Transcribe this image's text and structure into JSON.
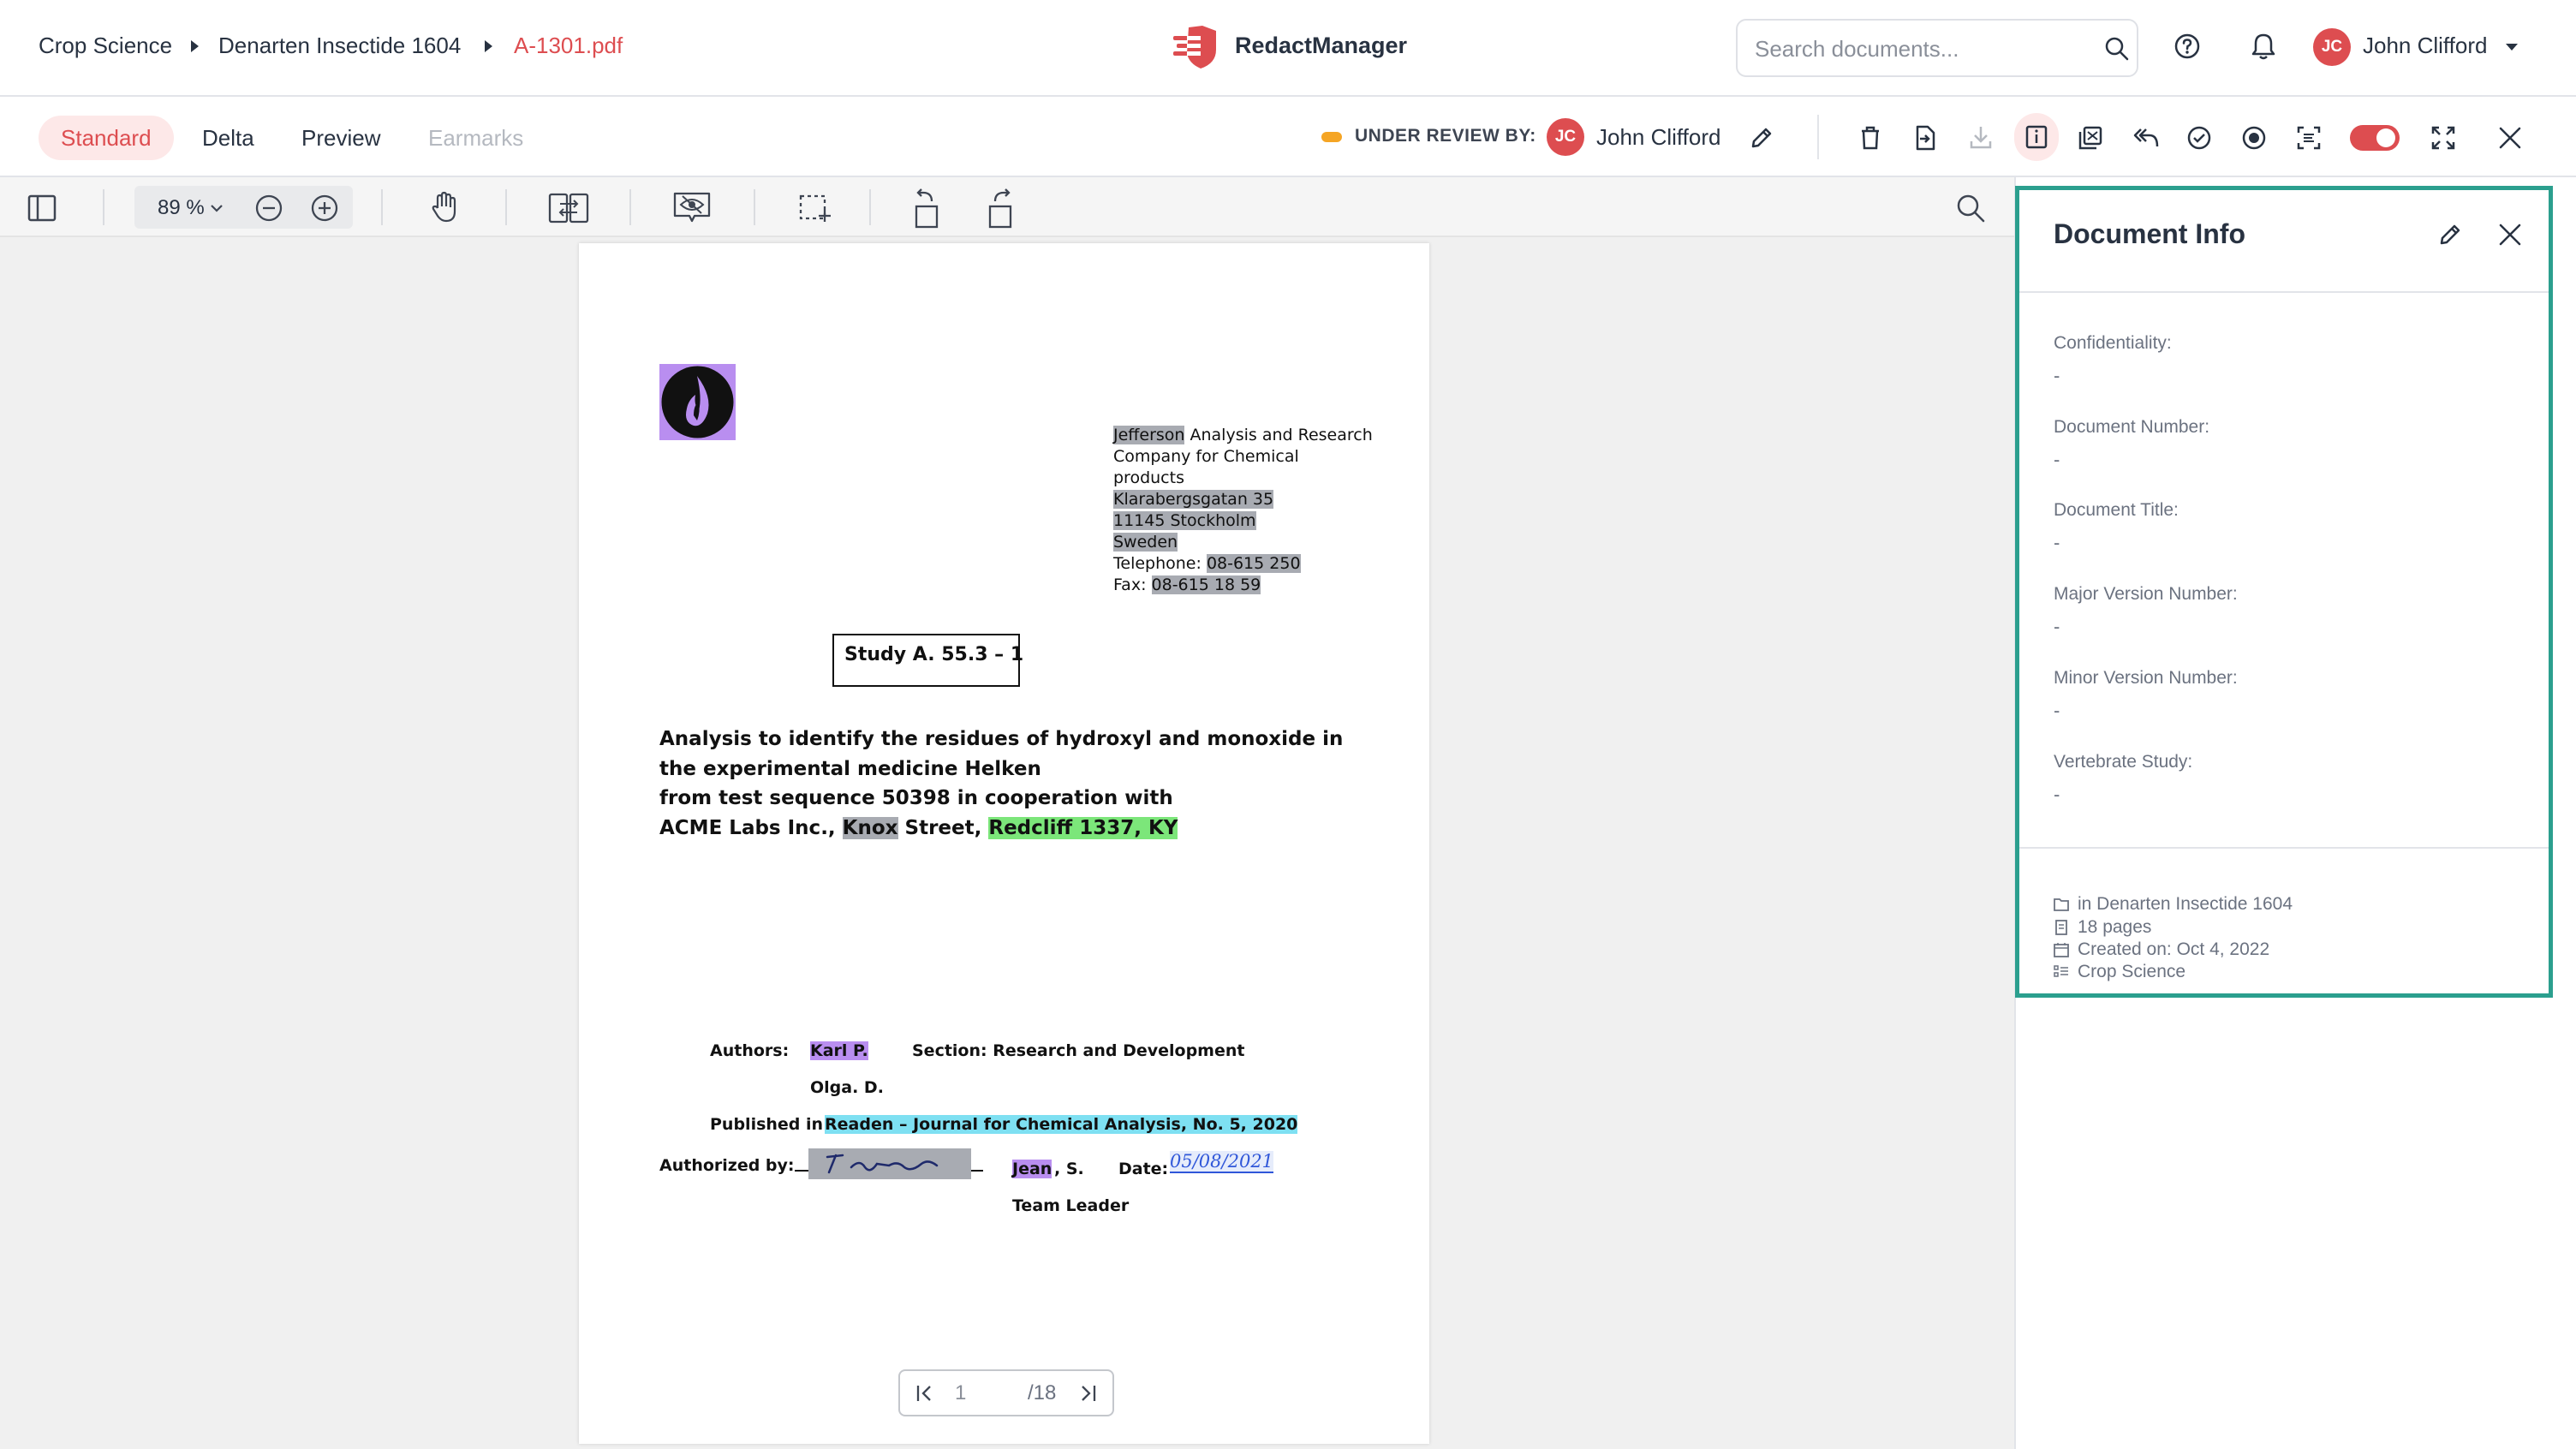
{
  "header": {
    "breadcrumbs": [
      "Crop Science",
      "Denarten Insectide 1604",
      "A-1301.pdf"
    ],
    "app_name": "RedactManager",
    "search": {
      "placeholder": "Search documents...",
      "value": ""
    },
    "user": {
      "initials": "JC",
      "name": "John Clifford"
    }
  },
  "subbar": {
    "tabs": [
      {
        "label": "Standard",
        "state": "active"
      },
      {
        "label": "Delta",
        "state": "normal"
      },
      {
        "label": "Preview",
        "state": "normal"
      },
      {
        "label": "Earmarks",
        "state": "disabled"
      }
    ],
    "status_label": "UNDER REVIEW BY:",
    "reviewer": {
      "initials": "JC",
      "name": "John Clifford"
    },
    "status_color": "#f5a524"
  },
  "viewer": {
    "zoom": "89 %",
    "pager": {
      "current": "1",
      "total": "/18"
    }
  },
  "document": {
    "address": {
      "line1_hl": "Jefferson",
      "line1_rest": " Analysis and Research",
      "line2": "Company for Chemical",
      "line3": "products",
      "line4": "Klarabergsgatan 35",
      "line5": "11145 Stockholm",
      "line6": "Sweden",
      "tel_label": "Telephone: ",
      "tel": "08-615 250",
      "fax_label": "Fax: ",
      "fax": "08-615 18 59"
    },
    "study_box": "Study A. 55.3 – 1",
    "title": {
      "line1": "Analysis to identify the residues of hydroxyl and monoxide in",
      "line2": "the experimental medicine Helken",
      "line3": "from test sequence 50398 in cooperation with",
      "line4_a": "ACME Labs Inc., ",
      "line4_hl1": "Knox",
      "line4_b": " Street, ",
      "line4_hl2": "Redcliff 1337, KY"
    },
    "authors_label": "Authors:",
    "author1": "Karl P.",
    "section": "Section: Research and Development",
    "author2": "Olga. D.",
    "published_label": "Published in: ",
    "published": "Readen – Journal for Chemical Analysis, No. 5, 2020",
    "authorized_label": "Authorized by:",
    "signer_hl": "Jean",
    "signer_rest": ", S.",
    "date_label": "Date:",
    "date_value": "05/08/2021",
    "role": "Team Leader"
  },
  "panel": {
    "title": "Document Info",
    "fields": [
      {
        "label": "Confidentiality:",
        "value": "-"
      },
      {
        "label": "Document Number:",
        "value": "-"
      },
      {
        "label": "Document Title:",
        "value": "-"
      },
      {
        "label": "Major Version Number:",
        "value": "-"
      },
      {
        "label": "Minor Version Number:",
        "value": "-"
      },
      {
        "label": "Vertebrate Study:",
        "value": "-"
      }
    ],
    "meta": {
      "folder": "in Denarten Insectide 1604",
      "pages": "18 pages",
      "created": "Created on: Oct 4, 2022",
      "dossier": "Crop Science"
    },
    "highlight_color": "#2b9f8e"
  },
  "colors": {
    "accent": "#dd4d50",
    "logo_icon": "#b98ef0"
  }
}
